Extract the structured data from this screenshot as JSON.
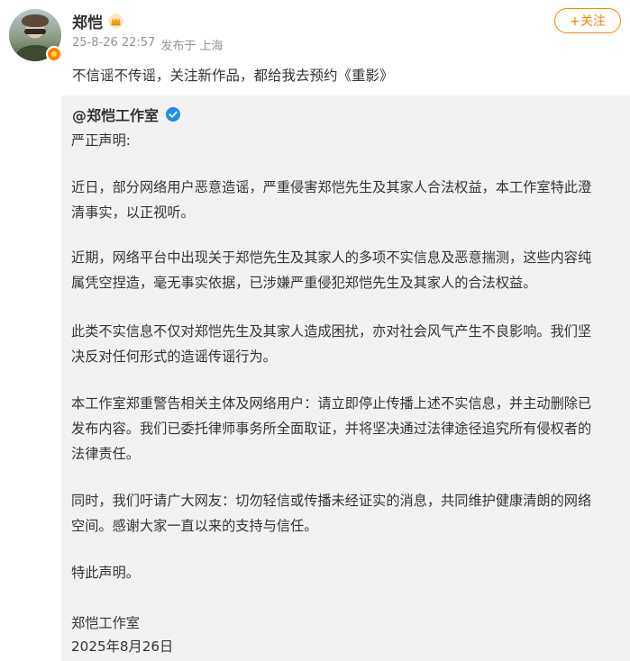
{
  "header": {
    "username": "郑恺",
    "timestamp": "25-8-26 22:57",
    "source": "发布于 上海",
    "follow_label": "+关注"
  },
  "post": {
    "text": "不信谣不传谣，关注新作品，都给我去预约《重影》"
  },
  "repost": {
    "author": "@郑恺工作室",
    "paragraphs": [
      "严正声明:",
      "近日，部分网络用户恶意造谣，严重侵害郑恺先生及其家人合法权益，本工作室特此澄",
      "清事实，以正视听。",
      "近期，网络平台中出现关于郑恺先生及其家人的多项不实信息及恶意揣测，这些内容纯",
      "属凭空捏造，毫无事实依据，已涉嫌严重侵犯郑恺先生及其家人的合法权益。",
      "此类不实信息不仅对郑恺先生及其家人造成困扰，亦对社会风气产生不良影响。我们坚",
      "决反对任何形式的造谣传谣行为。",
      "本工作室郑重警告相关主体及网络用户：请立即停止传播上述不实信息，并主动删除已",
      "发布内容。我们已委托律师事务所全面取证，并将坚决通过法律途径追究所有侵权者的",
      "法律责任。",
      "同时，我们吁请广大网友：切勿轻信或传播未经证实的消息，共同维护健康清朗的网络",
      "空间。感谢大家一直以来的支持与信任。",
      "特此声明。",
      "郑恺工作室",
      "2025年8月26日"
    ]
  },
  "icons": {
    "crown": "crown-icon",
    "verified": "verified-icon",
    "avatar_badge": "orange-vip-badge-icon"
  },
  "colors": {
    "accent": "#ff8200",
    "verified_blue": "#1d8eec",
    "meta_gray": "#939393",
    "card_bg": "#f2f2f2"
  }
}
